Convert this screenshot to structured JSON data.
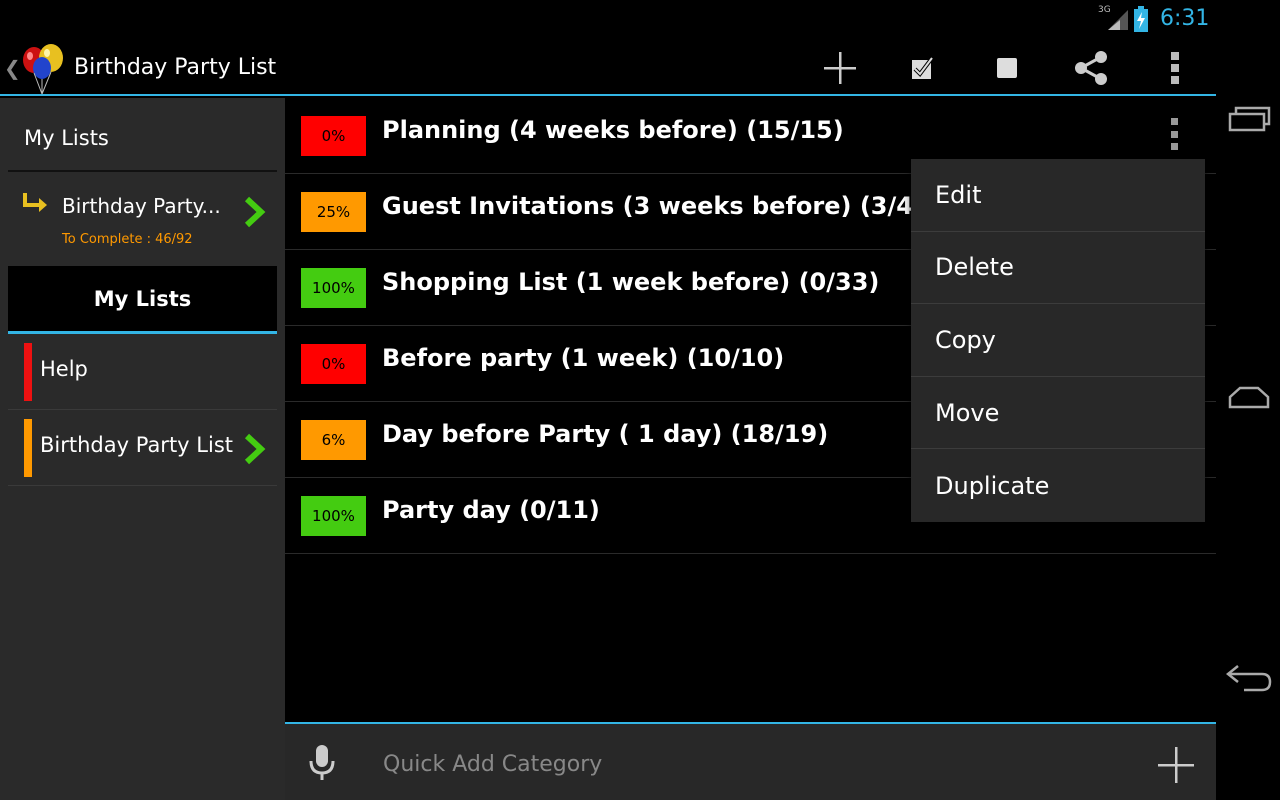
{
  "status": {
    "network": "3G",
    "time": "6:31"
  },
  "actionbar": {
    "title": "Birthday Party List",
    "icons": [
      "back-icon",
      "balloons-logo-icon",
      "add-icon",
      "checkbox-checked-icon",
      "checkbox-empty-icon",
      "share-icon",
      "overflow-icon"
    ]
  },
  "sidebar": {
    "header": "My Lists",
    "current_list": {
      "name": "Birthday Party...",
      "subtitle": "To Complete : 46/92"
    },
    "tab_label": "My Lists",
    "items": [
      {
        "label": "Help",
        "color": "#ee1111"
      },
      {
        "label": "Birthday Party List",
        "color": "#ff9900"
      }
    ]
  },
  "categories": [
    {
      "percent": "0%",
      "title": "Planning (4 weeks before) (15/15)",
      "color": "#ff0000"
    },
    {
      "percent": "25%",
      "title": "Guest Invitations (3 weeks before) (3/4)",
      "color": "#ff9900"
    },
    {
      "percent": "100%",
      "title": "Shopping List (1 week before) (0/33)",
      "color": "#44cc11"
    },
    {
      "percent": "0%",
      "title": "Before party (1 week) (10/10)",
      "color": "#ff0000"
    },
    {
      "percent": "6%",
      "title": "Day before Party ( 1 day) (18/19)",
      "color": "#ff9900"
    },
    {
      "percent": "100%",
      "title": "Party day (0/11)",
      "color": "#44cc11"
    }
  ],
  "popup_menu": [
    "Edit",
    "Delete",
    "Copy",
    "Move",
    "Duplicate"
  ],
  "quick_add": {
    "placeholder": "Quick Add Category"
  },
  "colors": {
    "accent": "#33b5e5",
    "panel": "#2a2a2a",
    "chevron": "#44cc11"
  }
}
